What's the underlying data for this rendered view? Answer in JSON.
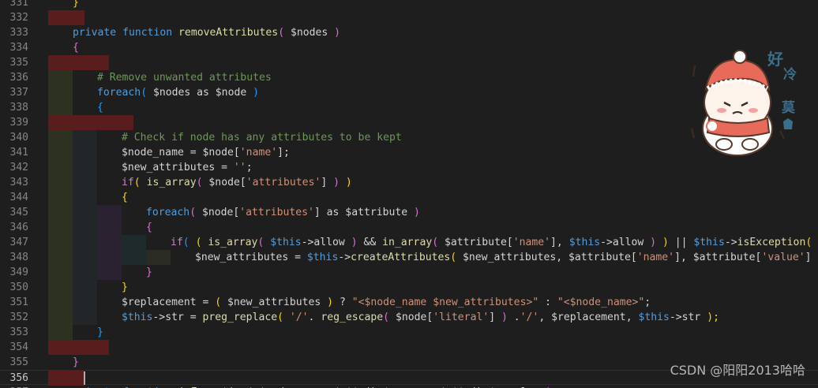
{
  "lines": [
    {
      "num": "331",
      "indent": 0,
      "tokens": [
        {
          "t": "}",
          "c": "br1"
        }
      ]
    },
    {
      "num": "332",
      "indent": 0,
      "err": 1,
      "tokens": []
    },
    {
      "num": "333",
      "indent": 0,
      "tokens": [
        {
          "t": "private",
          "c": "kw"
        },
        {
          "t": " "
        },
        {
          "t": "function",
          "c": "kw"
        },
        {
          "t": " "
        },
        {
          "t": "removeAttributes",
          "c": "fn"
        },
        {
          "t": "( ",
          "c": "br2"
        },
        {
          "t": "$nodes"
        },
        {
          "t": " )",
          "c": "br2"
        }
      ]
    },
    {
      "num": "334",
      "indent": 0,
      "tokens": [
        {
          "t": "{",
          "c": "br2"
        }
      ]
    },
    {
      "num": "335",
      "indent": 1,
      "err": 2,
      "tokens": []
    },
    {
      "num": "336",
      "indent": 1,
      "tokens": [
        {
          "t": "# Remove unwanted attributes",
          "c": "cm"
        }
      ]
    },
    {
      "num": "337",
      "indent": 1,
      "tokens": [
        {
          "t": "foreach",
          "c": "kw"
        },
        {
          "t": "( ",
          "c": "br3"
        },
        {
          "t": "$nodes as $node"
        },
        {
          "t": " )",
          "c": "br3"
        }
      ]
    },
    {
      "num": "338",
      "indent": 1,
      "tokens": [
        {
          "t": "{",
          "c": "br3"
        }
      ]
    },
    {
      "num": "339",
      "indent": 2,
      "err": 3,
      "tokens": []
    },
    {
      "num": "340",
      "indent": 2,
      "tokens": [
        {
          "t": "# Check if node has any attributes to be kept",
          "c": "cm"
        }
      ]
    },
    {
      "num": "341",
      "indent": 2,
      "tokens": [
        {
          "t": "$node_name = $node"
        },
        {
          "t": "["
        },
        {
          "t": "'name'",
          "c": "str"
        },
        {
          "t": "];"
        }
      ]
    },
    {
      "num": "342",
      "indent": 2,
      "tokens": [
        {
          "t": "$new_attributes = "
        },
        {
          "t": "''",
          "c": "str"
        },
        {
          "t": ";"
        }
      ]
    },
    {
      "num": "343",
      "indent": 2,
      "tokens": [
        {
          "t": "if",
          "c": "ctl"
        },
        {
          "t": "( ",
          "c": "br1"
        },
        {
          "t": "is_array",
          "c": "fn"
        },
        {
          "t": "( ",
          "c": "br2"
        },
        {
          "t": "$node["
        },
        {
          "t": "'attributes'",
          "c": "str"
        },
        {
          "t": "]"
        },
        {
          "t": " )",
          "c": "br2"
        },
        {
          "t": " )",
          "c": "br1"
        }
      ]
    },
    {
      "num": "344",
      "indent": 2,
      "tokens": [
        {
          "t": "{",
          "c": "br1"
        }
      ]
    },
    {
      "num": "345",
      "indent": 3,
      "tokens": [
        {
          "t": "foreach",
          "c": "kw"
        },
        {
          "t": "( ",
          "c": "br2"
        },
        {
          "t": "$node["
        },
        {
          "t": "'attributes'",
          "c": "str"
        },
        {
          "t": "] as $attribute"
        },
        {
          "t": " )",
          "c": "br2"
        }
      ]
    },
    {
      "num": "346",
      "indent": 3,
      "tokens": [
        {
          "t": "{",
          "c": "br2"
        }
      ]
    },
    {
      "num": "347",
      "indent": 4,
      "tokens": [
        {
          "t": "if",
          "c": "ctl"
        },
        {
          "t": "( ",
          "c": "br3"
        },
        {
          "t": "( ",
          "c": "br1"
        },
        {
          "t": "is_array",
          "c": "fn"
        },
        {
          "t": "( ",
          "c": "br2"
        },
        {
          "t": "$this",
          "c": "kw"
        },
        {
          "t": "->allow"
        },
        {
          "t": " )",
          "c": "br2"
        },
        {
          "t": " && "
        },
        {
          "t": "in_array",
          "c": "fn"
        },
        {
          "t": "( ",
          "c": "br2"
        },
        {
          "t": "$attribute["
        },
        {
          "t": "'name'",
          "c": "str"
        },
        {
          "t": "], "
        },
        {
          "t": "$this",
          "c": "kw"
        },
        {
          "t": "->allow"
        },
        {
          "t": " )",
          "c": "br2"
        },
        {
          "t": " )",
          "c": "br1"
        },
        {
          "t": " || "
        },
        {
          "t": "$this",
          "c": "kw"
        },
        {
          "t": "->"
        },
        {
          "t": "isException",
          "c": "fn"
        },
        {
          "t": "( ",
          "c": "br1"
        },
        {
          "t": "$node"
        }
      ]
    },
    {
      "num": "348",
      "indent": 5,
      "tokens": [
        {
          "t": "$new_attributes = "
        },
        {
          "t": "$this",
          "c": "kw"
        },
        {
          "t": "->"
        },
        {
          "t": "createAttributes",
          "c": "fn"
        },
        {
          "t": "( ",
          "c": "br1"
        },
        {
          "t": "$new_attributes, $attribute["
        },
        {
          "t": "'name'",
          "c": "str"
        },
        {
          "t": "], $attribute["
        },
        {
          "t": "'value'",
          "c": "str"
        },
        {
          "t": "]"
        },
        {
          "t": " );",
          "c": "br1"
        }
      ]
    },
    {
      "num": "349",
      "indent": 3,
      "tokens": [
        {
          "t": "}",
          "c": "br2"
        }
      ]
    },
    {
      "num": "350",
      "indent": 2,
      "tokens": [
        {
          "t": "}",
          "c": "br1"
        }
      ]
    },
    {
      "num": "351",
      "indent": 2,
      "tokens": [
        {
          "t": "$replacement = "
        },
        {
          "t": "( ",
          "c": "br1"
        },
        {
          "t": "$new_attributes"
        },
        {
          "t": " )",
          "c": "br1"
        },
        {
          "t": " ? "
        },
        {
          "t": "\"<$node_name $new_attributes>\"",
          "c": "str"
        },
        {
          "t": " : "
        },
        {
          "t": "\"<$node_name>\"",
          "c": "str"
        },
        {
          "t": ";"
        }
      ]
    },
    {
      "num": "352",
      "indent": 2,
      "tokens": [
        {
          "t": "$this",
          "c": "kw"
        },
        {
          "t": "->str = "
        },
        {
          "t": "preg_replace",
          "c": "fn"
        },
        {
          "t": "( ",
          "c": "br1"
        },
        {
          "t": "'/'",
          "c": "str"
        },
        {
          "t": ". "
        },
        {
          "t": "reg_escape",
          "c": "fn"
        },
        {
          "t": "( ",
          "c": "br2"
        },
        {
          "t": "$node["
        },
        {
          "t": "'literal'",
          "c": "str"
        },
        {
          "t": "]"
        },
        {
          "t": " )",
          "c": "br2"
        },
        {
          "t": " ."
        },
        {
          "t": "'/'",
          "c": "str"
        },
        {
          "t": ", $replacement, "
        },
        {
          "t": "$this",
          "c": "kw"
        },
        {
          "t": "->str"
        },
        {
          "t": " );",
          "c": "br1"
        }
      ]
    },
    {
      "num": "353",
      "indent": 1,
      "tokens": [
        {
          "t": "}",
          "c": "br3"
        }
      ]
    },
    {
      "num": "354",
      "indent": 1,
      "err": 2,
      "tokens": []
    },
    {
      "num": "355",
      "indent": 0,
      "tokens": [
        {
          "t": "}",
          "c": "br2"
        }
      ]
    },
    {
      "num": "356",
      "indent": 0,
      "err": 1,
      "current": true,
      "tokens": []
    },
    {
      "num": "357",
      "indent": 0,
      "tokens": [
        {
          "t": "private",
          "c": "kw"
        },
        {
          "t": " "
        },
        {
          "t": "function",
          "c": "kw"
        },
        {
          "t": " "
        },
        {
          "t": "isException",
          "c": "fn"
        },
        {
          "t": "( ",
          "c": "br2"
        },
        {
          "t": "$node_name, $attribute_name, $attribute_value"
        },
        {
          "t": " )",
          "c": "br2"
        }
      ]
    }
  ],
  "sticker": {
    "chars": [
      "好",
      "冷",
      "莫"
    ]
  },
  "watermark": "CSDN @阳阳2013哈哈"
}
